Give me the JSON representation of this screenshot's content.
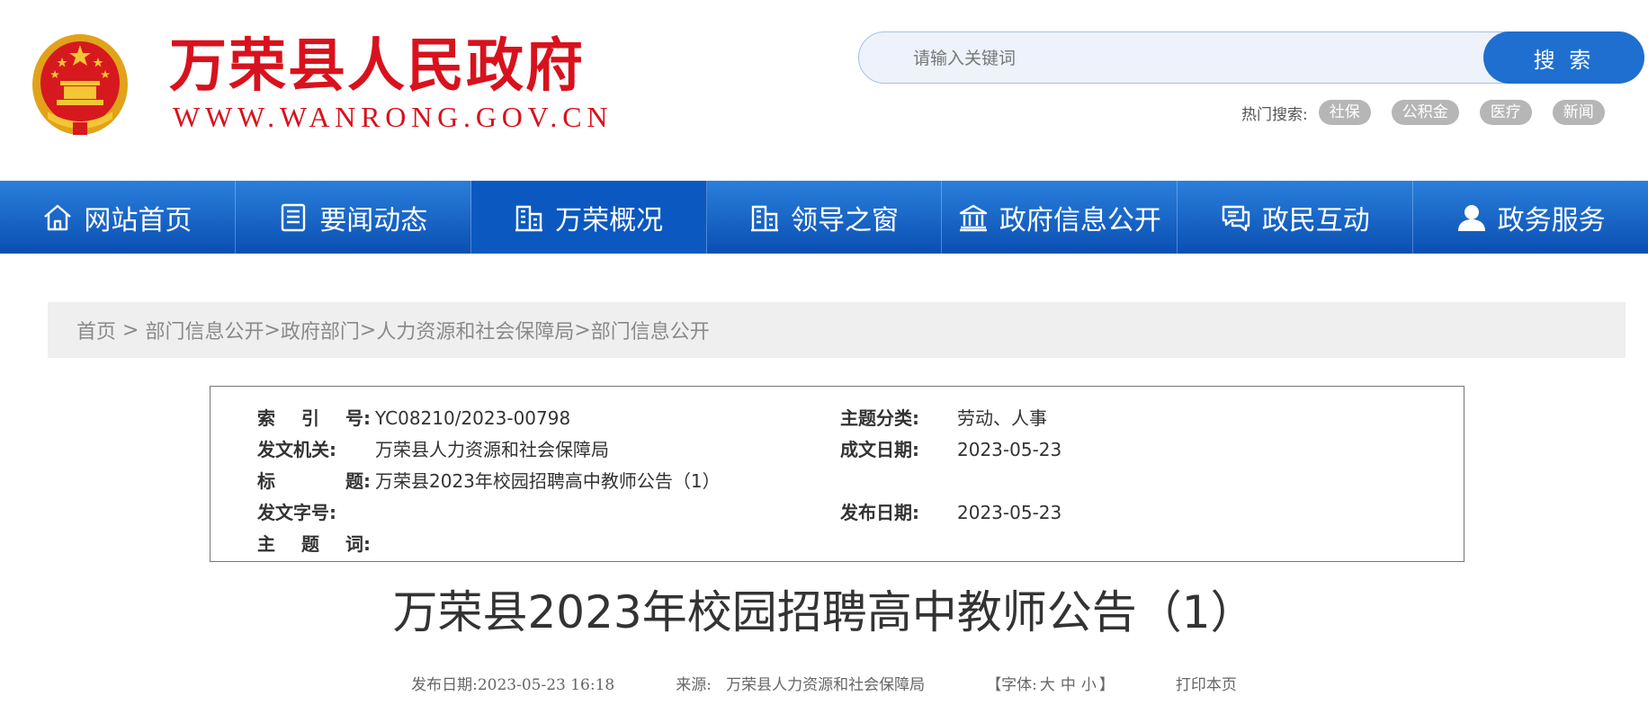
{
  "header": {
    "site_title": "万荣县人民政府",
    "site_url": "WWW.WANRONG.GOV.CN",
    "search_placeholder": "请输入关键词",
    "search_button": "搜 索",
    "hot_label": "热门搜索:",
    "hot_tags": [
      "社保",
      "公积金",
      "医疗",
      "新闻"
    ]
  },
  "nav": {
    "items": [
      {
        "label": "网站首页",
        "icon": "home-icon"
      },
      {
        "label": "要闻动态",
        "icon": "document-icon"
      },
      {
        "label": "万荣概况",
        "icon": "building-icon",
        "active": true
      },
      {
        "label": "领导之窗",
        "icon": "building-icon"
      },
      {
        "label": "政府信息公开",
        "icon": "government-icon"
      },
      {
        "label": "政民互动",
        "icon": "chat-icon"
      },
      {
        "label": "政务服务",
        "icon": "user-icon"
      }
    ]
  },
  "breadcrumb": {
    "items": [
      "首页",
      "部门信息公开",
      "政府部门",
      "人力资源和社会保障局",
      "部门信息公开"
    ],
    "sep_first": " > ",
    "sep": ">"
  },
  "meta": {
    "index_no": {
      "label_chars": [
        "索",
        "引",
        "号:"
      ],
      "value": "YC08210/2023-00798"
    },
    "issuer": {
      "label_chars": [
        "发文机关:"
      ],
      "value": "万荣县人力资源和社会保障局"
    },
    "title": {
      "label_chars": [
        "标",
        "题:"
      ],
      "value": "万荣县2023年校园招聘高中教师公告（1）"
    },
    "doc_no": {
      "label_chars": [
        "发文字号:"
      ],
      "value": ""
    },
    "keywords": {
      "label_chars": [
        "主",
        "题",
        "词:"
      ],
      "value": ""
    },
    "category": {
      "label": "主题分类:",
      "value": "劳动、人事"
    },
    "created": {
      "label": "成文日期:",
      "value": "2023-05-23"
    },
    "published": {
      "label": "发布日期:",
      "value": "2023-05-23"
    }
  },
  "article": {
    "title": "万荣县2023年校园招聘高中教师公告（1）",
    "publish_label": "发布日期:",
    "publish_time": "2023-05-23 16:18",
    "source_label": "来源:",
    "source": "万荣县人力资源和社会保障局",
    "font_label_open": "【字体:",
    "font_sizes": [
      "大",
      "中",
      "小"
    ],
    "font_label_close": "】",
    "print": "打印本页"
  },
  "colors": {
    "brand_red": "#d8121d",
    "nav_blue": "#1e6fd0",
    "breadcrumb_bg": "#efefef"
  }
}
